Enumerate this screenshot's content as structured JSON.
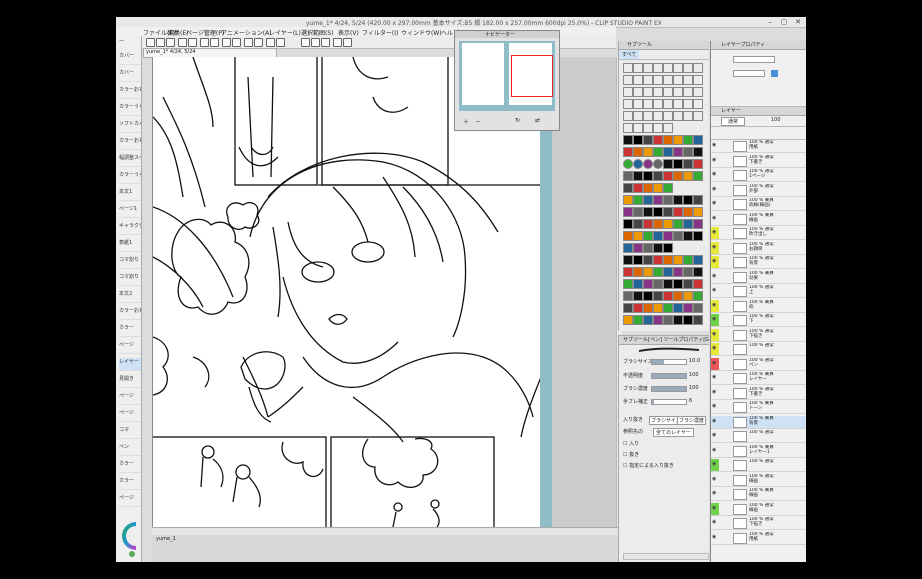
{
  "window": {
    "title": "yume_1* 4/24, 5/24 (420.00 x 297.00mm 基本サイズ:B5 綴 182.00 x 257.00mm 600dpi 25.0%) - CLIP STUDIO PAINT EX",
    "minimize_icon": "minimize-icon",
    "maximize_icon": "maximize-icon",
    "close_icon": "close-icon"
  },
  "menu": {
    "items": [
      "ファイル(F)",
      "編集(E)",
      "ページ管理(P)",
      "アニメーション(A)",
      "レイヤー(L)",
      "選択範囲(S)",
      "表示(V)",
      "フィルター(I)",
      "ウィンドウ(W)",
      "ヘルプ(H)"
    ]
  },
  "document": {
    "tab": "yume_1* 4/24, 5/24",
    "bottom_tab": "yume_1"
  },
  "left_panel": {
    "header": "ー",
    "items": [
      "カバー",
      "カバー",
      "カラーおもて",
      "カラーうら",
      "ソフトカバー",
      "カラーおもて2",
      "幅調整スペース",
      "カラーうら2",
      "本文1",
      "ページ1",
      "キャラクター",
      "表紙1",
      "コマ割り",
      "コマ割り",
      "本文2",
      "カラーおもて",
      "カラー",
      "ページ",
      "レイヤー",
      "見開き",
      "ページ",
      "ページ",
      "コマ",
      "ペン",
      "カラー",
      "カラー",
      "ページ"
    ],
    "selected_index": 18
  },
  "navigator": {
    "title": "ナビゲーター"
  },
  "tool_panel": {
    "header": "ツール",
    "tabs": [
      "すべて"
    ],
    "title2": "サブツール"
  },
  "sub_tool_detail": {
    "header": "サブツール[ペン]  ツールプロパティ[Gペン]",
    "brush_size_label": "ブラシサイズ",
    "brush_size_value": "10.0",
    "opacity_label": "不透明度",
    "opacity_value": "100",
    "density_label": "ブラシ濃度",
    "density_value": "100",
    "stabilization_label": "手ブレ補正",
    "stabilization_value": "6",
    "input_label": "入り抜き",
    "input_options": [
      "ブラシサイズ",
      "ブラシ濃度"
    ],
    "ref_label": "参照先の",
    "ref_value": "全てのレイヤー",
    "checkbox_1": "入り",
    "checkbox_2": "抜き",
    "checkbox_3": "指定による入り抜き",
    "brush_size_fraction": 0.35,
    "opacity_fraction": 1.0,
    "density_fraction": 1.0,
    "stabilization_fraction": 0.06
  },
  "layer_panel": {
    "header": "レイヤープロパティ",
    "header2": "レイヤー",
    "blend": "通常",
    "opacity": "100",
    "layers": [
      {
        "name": "100 % 通常\n用紙",
        "color": "none"
      },
      {
        "name": "100 % 通常\n下書き",
        "color": "none"
      },
      {
        "name": "100 % 通常\n1ページ",
        "color": "none"
      },
      {
        "name": "100 % 通常\n外部",
        "color": "none"
      },
      {
        "name": "100 % 乗算\n枠線(線画)",
        "color": "none"
      },
      {
        "name": "100 % 乗算\n線画",
        "color": "none"
      },
      {
        "name": "100 % 通常\n吹き出し",
        "color": "yellow"
      },
      {
        "name": "100 % 通常\nお題目",
        "color": "yellow"
      },
      {
        "name": "100 % 通常\n背景",
        "color": "yellow"
      },
      {
        "name": "100 % 乗算\n効果",
        "color": "none"
      },
      {
        "name": "100 % 通常\n上",
        "color": "none"
      },
      {
        "name": "100 % 乗算\n枠",
        "color": "yellow"
      },
      {
        "name": "100 % 通常\n下",
        "color": "green"
      },
      {
        "name": "100 % 通常\n下描き",
        "color": "yellow"
      },
      {
        "name": "100 % 通常\n",
        "color": "yellow"
      },
      {
        "name": "100 % 通常\nペン",
        "color": "red"
      },
      {
        "name": "100 % 乗算\nレイヤー",
        "color": "none"
      },
      {
        "name": "100 % 通常\n下書き",
        "color": "none"
      },
      {
        "name": "100 % 乗算\nトーン",
        "color": "none"
      },
      {
        "name": "100 % 乗算\n背景",
        "color": "none"
      },
      {
        "name": "100 % 通常\n",
        "color": "none"
      },
      {
        "name": "100 % 乗算\nレイヤー1",
        "color": "none"
      },
      {
        "name": "100 % 通常\n",
        "color": "green"
      },
      {
        "name": "100 % 通常\n線画",
        "color": "none"
      },
      {
        "name": "100 % 乗算\n線画",
        "color": "none"
      },
      {
        "name": "100 % 通常\n線画",
        "color": "green"
      },
      {
        "name": "100 % 通常\n下描き",
        "color": "none"
      },
      {
        "name": "100 % 通常\n用紙",
        "color": "none"
      }
    ],
    "selected_index": 19
  },
  "colors": {
    "accent": "#cfe2f5",
    "yellow": "#e6e83a",
    "green": "#6fd24a",
    "red": "#f05555",
    "canvas_bg": "#8fbcc6"
  }
}
